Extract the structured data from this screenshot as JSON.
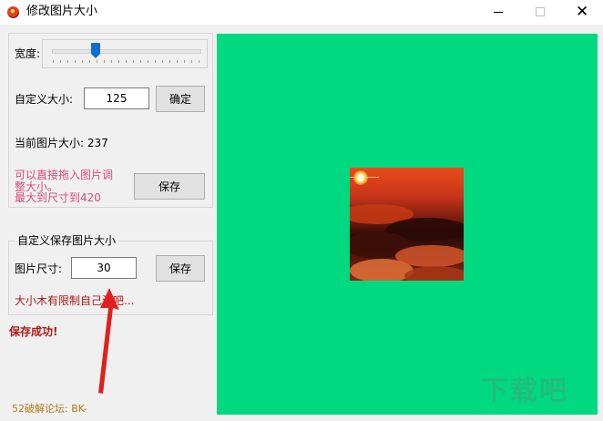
{
  "window": {
    "title": "修改图片大小",
    "close_glyph": "✕"
  },
  "width_row": {
    "label": "宽度:",
    "slider_value": 0.29,
    "tick_count": 21
  },
  "custom_size": {
    "label": "自定义大小:",
    "value": "125",
    "confirm_label": "确定"
  },
  "current_size": {
    "text": "当前图片大小: 237"
  },
  "hint": {
    "line1": "可以直接拖入图片调",
    "line2": "整大小。",
    "line3": "最大到尺寸到420"
  },
  "save_top_label": "保存",
  "custom_save": {
    "group_title": "自定义保存图片大小",
    "label": "图片尺寸:",
    "value": "30",
    "save_label": "保存",
    "warning": "大小木有限制自己注吧..."
  },
  "status": {
    "text": "保存成功!"
  },
  "footer": {
    "credit": "52破解论坛: BK-"
  },
  "watermark_text": "下载吧",
  "colors": {
    "preview_bg": "#00d980",
    "hint": "#e0487a",
    "warning": "#b01818",
    "credit": "#b27a1c",
    "slider_thumb": "#0a6ed1",
    "arrow": "#e02020"
  }
}
